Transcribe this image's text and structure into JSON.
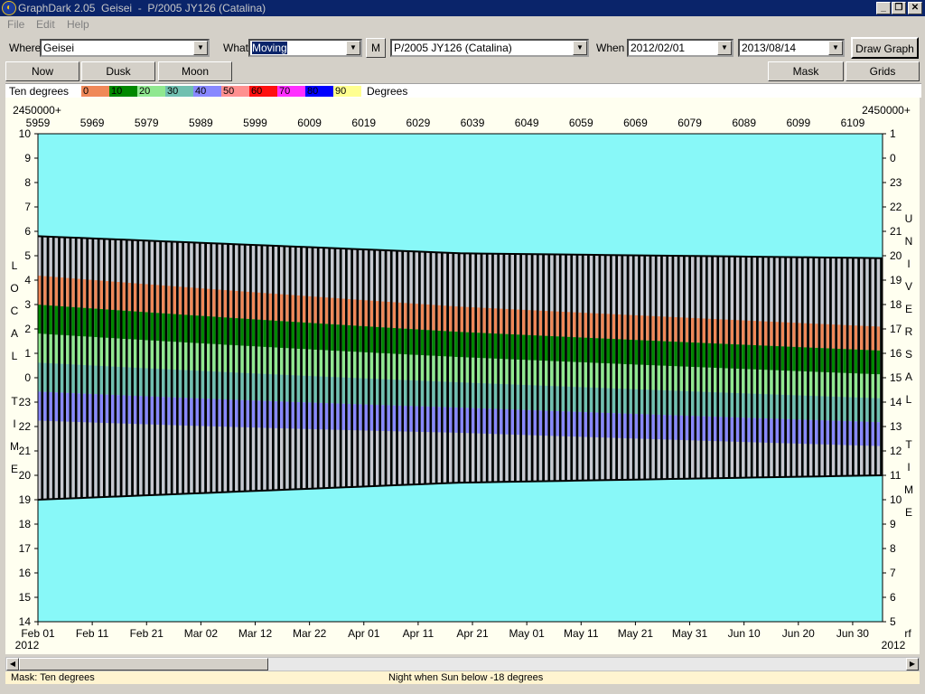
{
  "window": {
    "title": "GraphDark 2.05  Geisei  -  P/2005 JY126 (Catalina)",
    "buttons": {
      "minimize": "_",
      "restore": "❐",
      "close": "✕"
    }
  },
  "menu": [
    {
      "label": "File"
    },
    {
      "label": "Edit"
    },
    {
      "label": "Help"
    }
  ],
  "toolbar": {
    "where_label": "Where",
    "where_value": "Geisei",
    "what_label": "What",
    "what_value": "Moving",
    "m_button": "M",
    "object_value": "P/2005 JY126 (Catalina)",
    "when_label": "When",
    "start_date": "2012/02/01",
    "end_date": "2013/08/14",
    "draw_button": "Draw Graph"
  },
  "buttons": {
    "now": "Now",
    "dusk": "Dusk",
    "moon": "Moon",
    "mask": "Mask",
    "grids": "Grids"
  },
  "legend": {
    "title": "Ten degrees",
    "unit": "Degrees",
    "levels": [
      {
        "label": "0",
        "color": "#f08858"
      },
      {
        "label": "10",
        "color": "#008800"
      },
      {
        "label": "20",
        "color": "#90e890"
      },
      {
        "label": "30",
        "color": "#70c0b0"
      },
      {
        "label": "40",
        "color": "#8888ff"
      },
      {
        "label": "50",
        "color": "#ff9090"
      },
      {
        "label": "60",
        "color": "#ff1010"
      },
      {
        "label": "70",
        "color": "#ff30ff"
      },
      {
        "label": "80",
        "color": "#0000ff"
      },
      {
        "label": "90",
        "color": "#ffff90"
      }
    ]
  },
  "chart_data": {
    "type": "area",
    "jd_prefix_left": "2450000+",
    "jd_prefix_right": "2450000+",
    "jd_ticks": [
      "5959",
      "5969",
      "5979",
      "5989",
      "5999",
      "6009",
      "6019",
      "6029",
      "6039",
      "6049",
      "6059",
      "6069",
      "6079",
      "6089",
      "6099",
      "6109"
    ],
    "date_ticks": [
      "Feb 01",
      "Feb 11",
      "Feb 21",
      "Mar 02",
      "Mar 12",
      "Mar 22",
      "Apr 01",
      "Apr 11",
      "Apr 21",
      "May 01",
      "May 11",
      "May 21",
      "May 31",
      "Jun 10",
      "Jun 20",
      "Jun 30"
    ],
    "year_left": "2012",
    "year_right": "2012",
    "right_edge_label": "rf",
    "local_time_ticks": [
      "10",
      "9",
      "8",
      "7",
      "6",
      "5",
      "4",
      "3",
      "2",
      "1",
      "0",
      "23",
      "22",
      "21",
      "20",
      "19",
      "18",
      "17",
      "16",
      "15",
      "14"
    ],
    "ut_ticks": [
      "1",
      "0",
      "23",
      "22",
      "21",
      "20",
      "19",
      "18",
      "17",
      "16",
      "15",
      "14",
      "13",
      "12",
      "11",
      "10",
      "9",
      "8",
      "7",
      "6",
      "5"
    ],
    "left_axis_title": [
      "L",
      "O",
      "C",
      "A",
      "L",
      "",
      "T",
      "I",
      "M",
      "E"
    ],
    "right_axis_title": [
      "U",
      "N",
      "I",
      "V",
      "E",
      "R",
      "S",
      "A",
      "L",
      "",
      "T",
      "I",
      "M",
      "E"
    ],
    "night_start_hours": [
      19.0,
      19.7,
      20.0
    ],
    "night_end_hours": [
      5.8,
      5.1,
      4.9
    ]
  },
  "status": {
    "mask": "Mask:  Ten degrees",
    "night": "Night when Sun below -18 degrees"
  },
  "colors": {
    "sky": "#88f8f8",
    "moonlit_dark": "#c8c8d0",
    "dark_sky": "#0a0a40",
    "below_horizon": "#1080c8"
  }
}
